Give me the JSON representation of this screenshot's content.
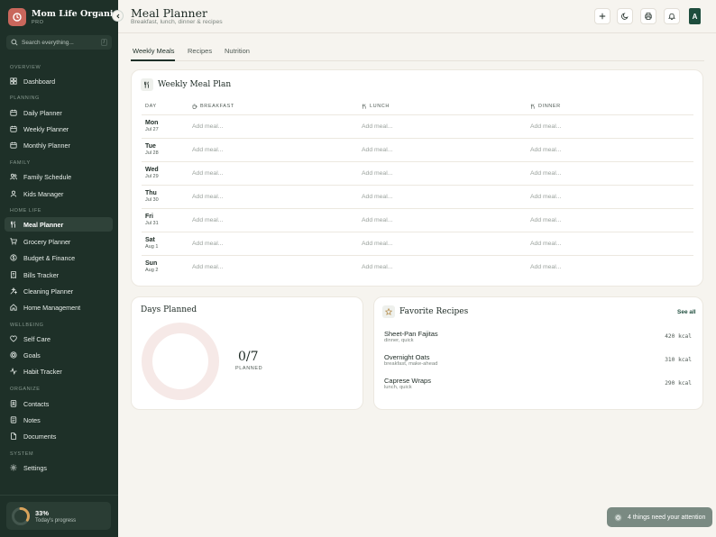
{
  "app": {
    "title": "Mom Life Organizer",
    "tier": "PRO"
  },
  "search": {
    "placeholder": "Search everything...",
    "shortcut": "/"
  },
  "sidebar": {
    "sections": [
      {
        "label": "OVERVIEW"
      },
      {
        "label": "PLANNING"
      },
      {
        "label": "FAMILY"
      },
      {
        "label": "HOME LIFE"
      },
      {
        "label": "WELLBEING"
      },
      {
        "label": "ORGANIZE"
      },
      {
        "label": "SYSTEM"
      }
    ],
    "items": [
      {
        "label": "Dashboard",
        "icon": "grid-icon"
      },
      {
        "label": "Daily Planner",
        "icon": "calendar-icon"
      },
      {
        "label": "Weekly Planner",
        "icon": "calendar-icon"
      },
      {
        "label": "Monthly Planner",
        "icon": "calendar-icon"
      },
      {
        "label": "Family Schedule",
        "icon": "users-icon"
      },
      {
        "label": "Kids Manager",
        "icon": "user-icon"
      },
      {
        "label": "Meal Planner",
        "icon": "utensils-icon",
        "active": true
      },
      {
        "label": "Grocery Planner",
        "icon": "cart-icon"
      },
      {
        "label": "Budget & Finance",
        "icon": "wallet-icon"
      },
      {
        "label": "Bills Tracker",
        "icon": "receipt-icon"
      },
      {
        "label": "Cleaning Planner",
        "icon": "sparkle-icon"
      },
      {
        "label": "Home Management",
        "icon": "home-icon"
      },
      {
        "label": "Self Care",
        "icon": "heart-icon"
      },
      {
        "label": "Goals",
        "icon": "target-icon"
      },
      {
        "label": "Habit Tracker",
        "icon": "activity-icon"
      },
      {
        "label": "Contacts",
        "icon": "contact-icon"
      },
      {
        "label": "Notes",
        "icon": "note-icon"
      },
      {
        "label": "Documents",
        "icon": "document-icon"
      },
      {
        "label": "Settings",
        "icon": "gear-icon"
      }
    ],
    "progress": {
      "percent_label": "33%",
      "percent": 0.33,
      "caption": "Today's progress"
    }
  },
  "header": {
    "title": "Meal Planner",
    "subtitle": "Breakfast, lunch, dinner & recipes",
    "avatar_initial": "A"
  },
  "tabs": [
    "Weekly Meals",
    "Recipes",
    "Nutrition"
  ],
  "meal_plan": {
    "title": "Weekly Meal Plan",
    "columns": [
      "DAY",
      "BREAKFAST",
      "LUNCH",
      "DINNER"
    ],
    "placeholder": "Add meal...",
    "days": [
      {
        "name": "Mon",
        "date": "Jul 27"
      },
      {
        "name": "Tue",
        "date": "Jul 28"
      },
      {
        "name": "Wed",
        "date": "Jul 29"
      },
      {
        "name": "Thu",
        "date": "Jul 30"
      },
      {
        "name": "Fri",
        "date": "Jul 31"
      },
      {
        "name": "Sat",
        "date": "Aug 1"
      },
      {
        "name": "Sun",
        "date": "Aug 2"
      }
    ]
  },
  "days_planned": {
    "title": "Days Planned",
    "value_label": "0/7",
    "planned": 0,
    "total": 7,
    "caption": "PLANNED"
  },
  "favorites": {
    "title": "Favorite Recipes",
    "see_all": "See all",
    "recipes": [
      {
        "name": "Sheet-Pan Fajitas",
        "tags": "dinner, quick",
        "kcal": "420 kcal"
      },
      {
        "name": "Overnight Oats",
        "tags": "breakfast, make-ahead",
        "kcal": "310 kcal"
      },
      {
        "name": "Caprese Wraps",
        "tags": "lunch, quick",
        "kcal": "290 kcal"
      }
    ]
  },
  "toast": {
    "text": "4 things need your attention"
  },
  "colors": {
    "sidebar": "#1e3028",
    "accent": "#1e4d3d",
    "brand": "#c9675c",
    "progress": "#d9a35b",
    "ring": "#f6e9e7"
  }
}
